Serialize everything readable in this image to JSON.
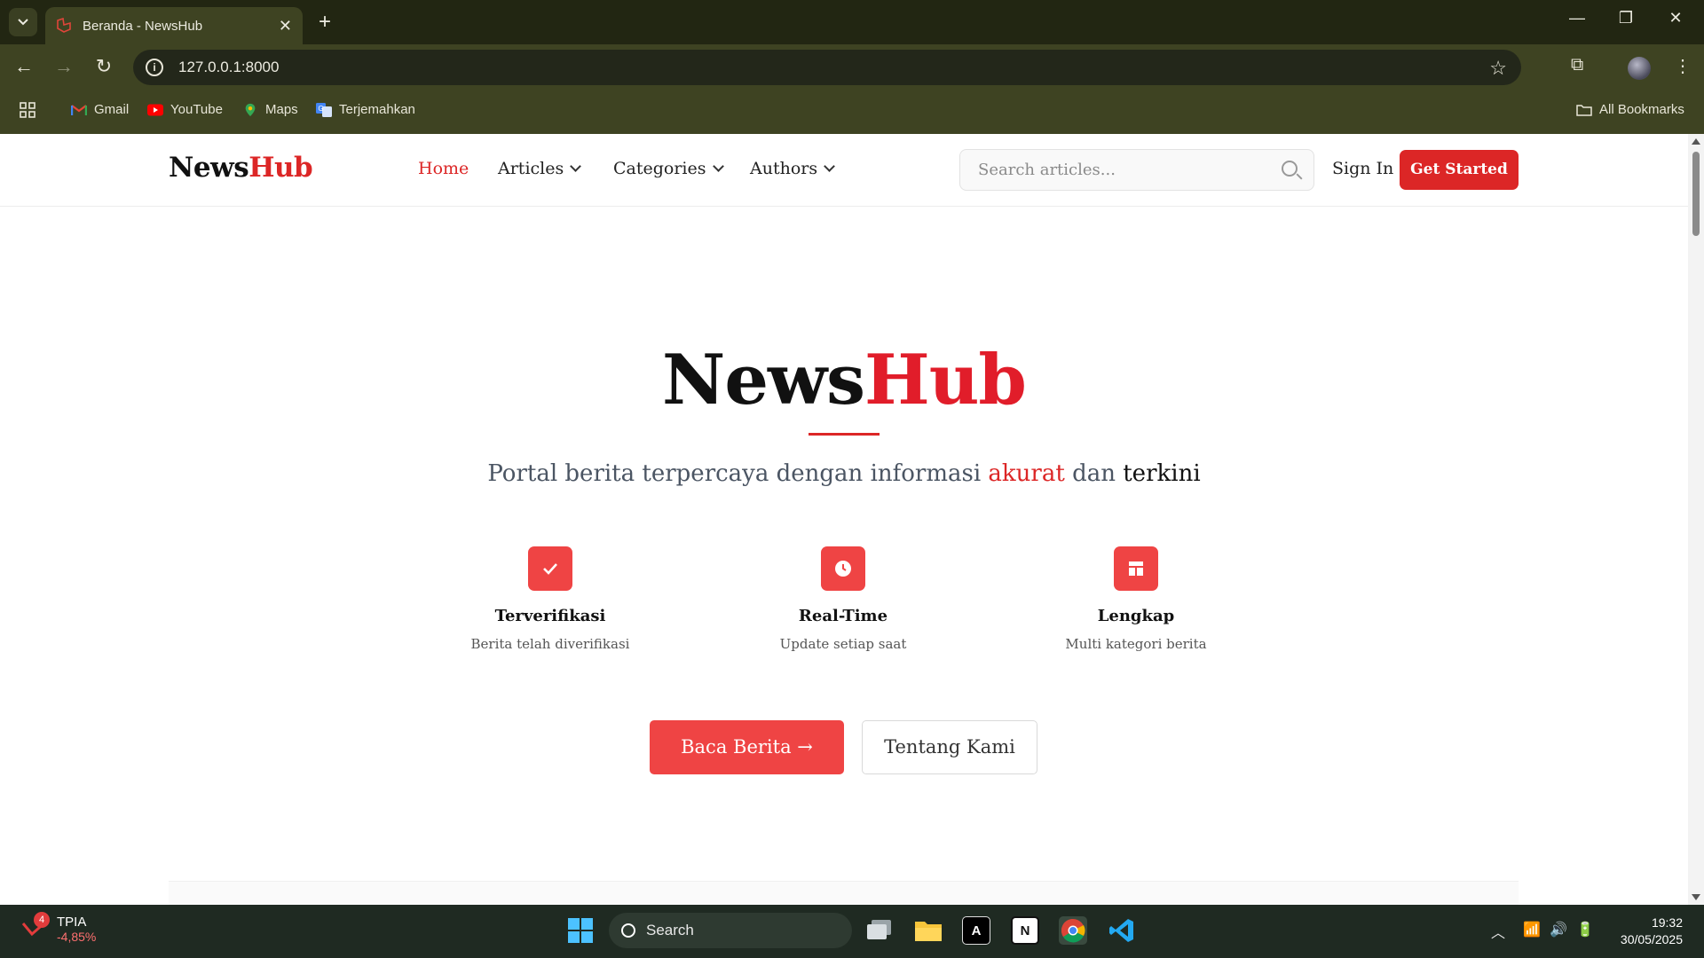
{
  "browser": {
    "tab_title": "Beranda - NewsHub",
    "url": "127.0.0.1:8000",
    "bookmarks": [
      {
        "label": "Gmail",
        "icon": "gmail-icon"
      },
      {
        "label": "YouTube",
        "icon": "youtube-icon"
      },
      {
        "label": "Maps",
        "icon": "maps-icon"
      },
      {
        "label": "Terjemahkan",
        "icon": "translate-icon"
      }
    ],
    "all_bookmarks": "All Bookmarks"
  },
  "header": {
    "logo_part1": "News",
    "logo_part2": "Hub",
    "nav": [
      {
        "label": "Home"
      },
      {
        "label": "Articles"
      },
      {
        "label": "Categories"
      },
      {
        "label": "Authors"
      }
    ],
    "search_placeholder": "Search articles...",
    "sign_in": "Sign In",
    "get_started": "Get Started"
  },
  "hero": {
    "title_part1": "News",
    "title_part2": "Hub",
    "tagline_start": "Portal berita terpercaya dengan informasi",
    "tagline_accent": "akurat",
    "tagline_mid": "dan",
    "tagline_end": "terkini",
    "features": [
      {
        "title": "Terverifikasi",
        "desc": "Berita telah diverifikasi",
        "icon": "check-icon"
      },
      {
        "title": "Real-Time",
        "desc": "Update setiap saat",
        "icon": "clock-icon"
      },
      {
        "title": "Lengkap",
        "desc": "Multi kategori berita",
        "icon": "layout-icon"
      }
    ],
    "primary_button": "Baca Berita →",
    "secondary_button": "Tentang Kami"
  },
  "taskbar": {
    "stock_name": "TPIA",
    "stock_change": "-4,85%",
    "notification_count": "4",
    "search_label": "Search",
    "time": "19:32",
    "date": "30/05/2025"
  },
  "colors": {
    "accent": "#dc2626",
    "chrome": "#3e4322"
  }
}
